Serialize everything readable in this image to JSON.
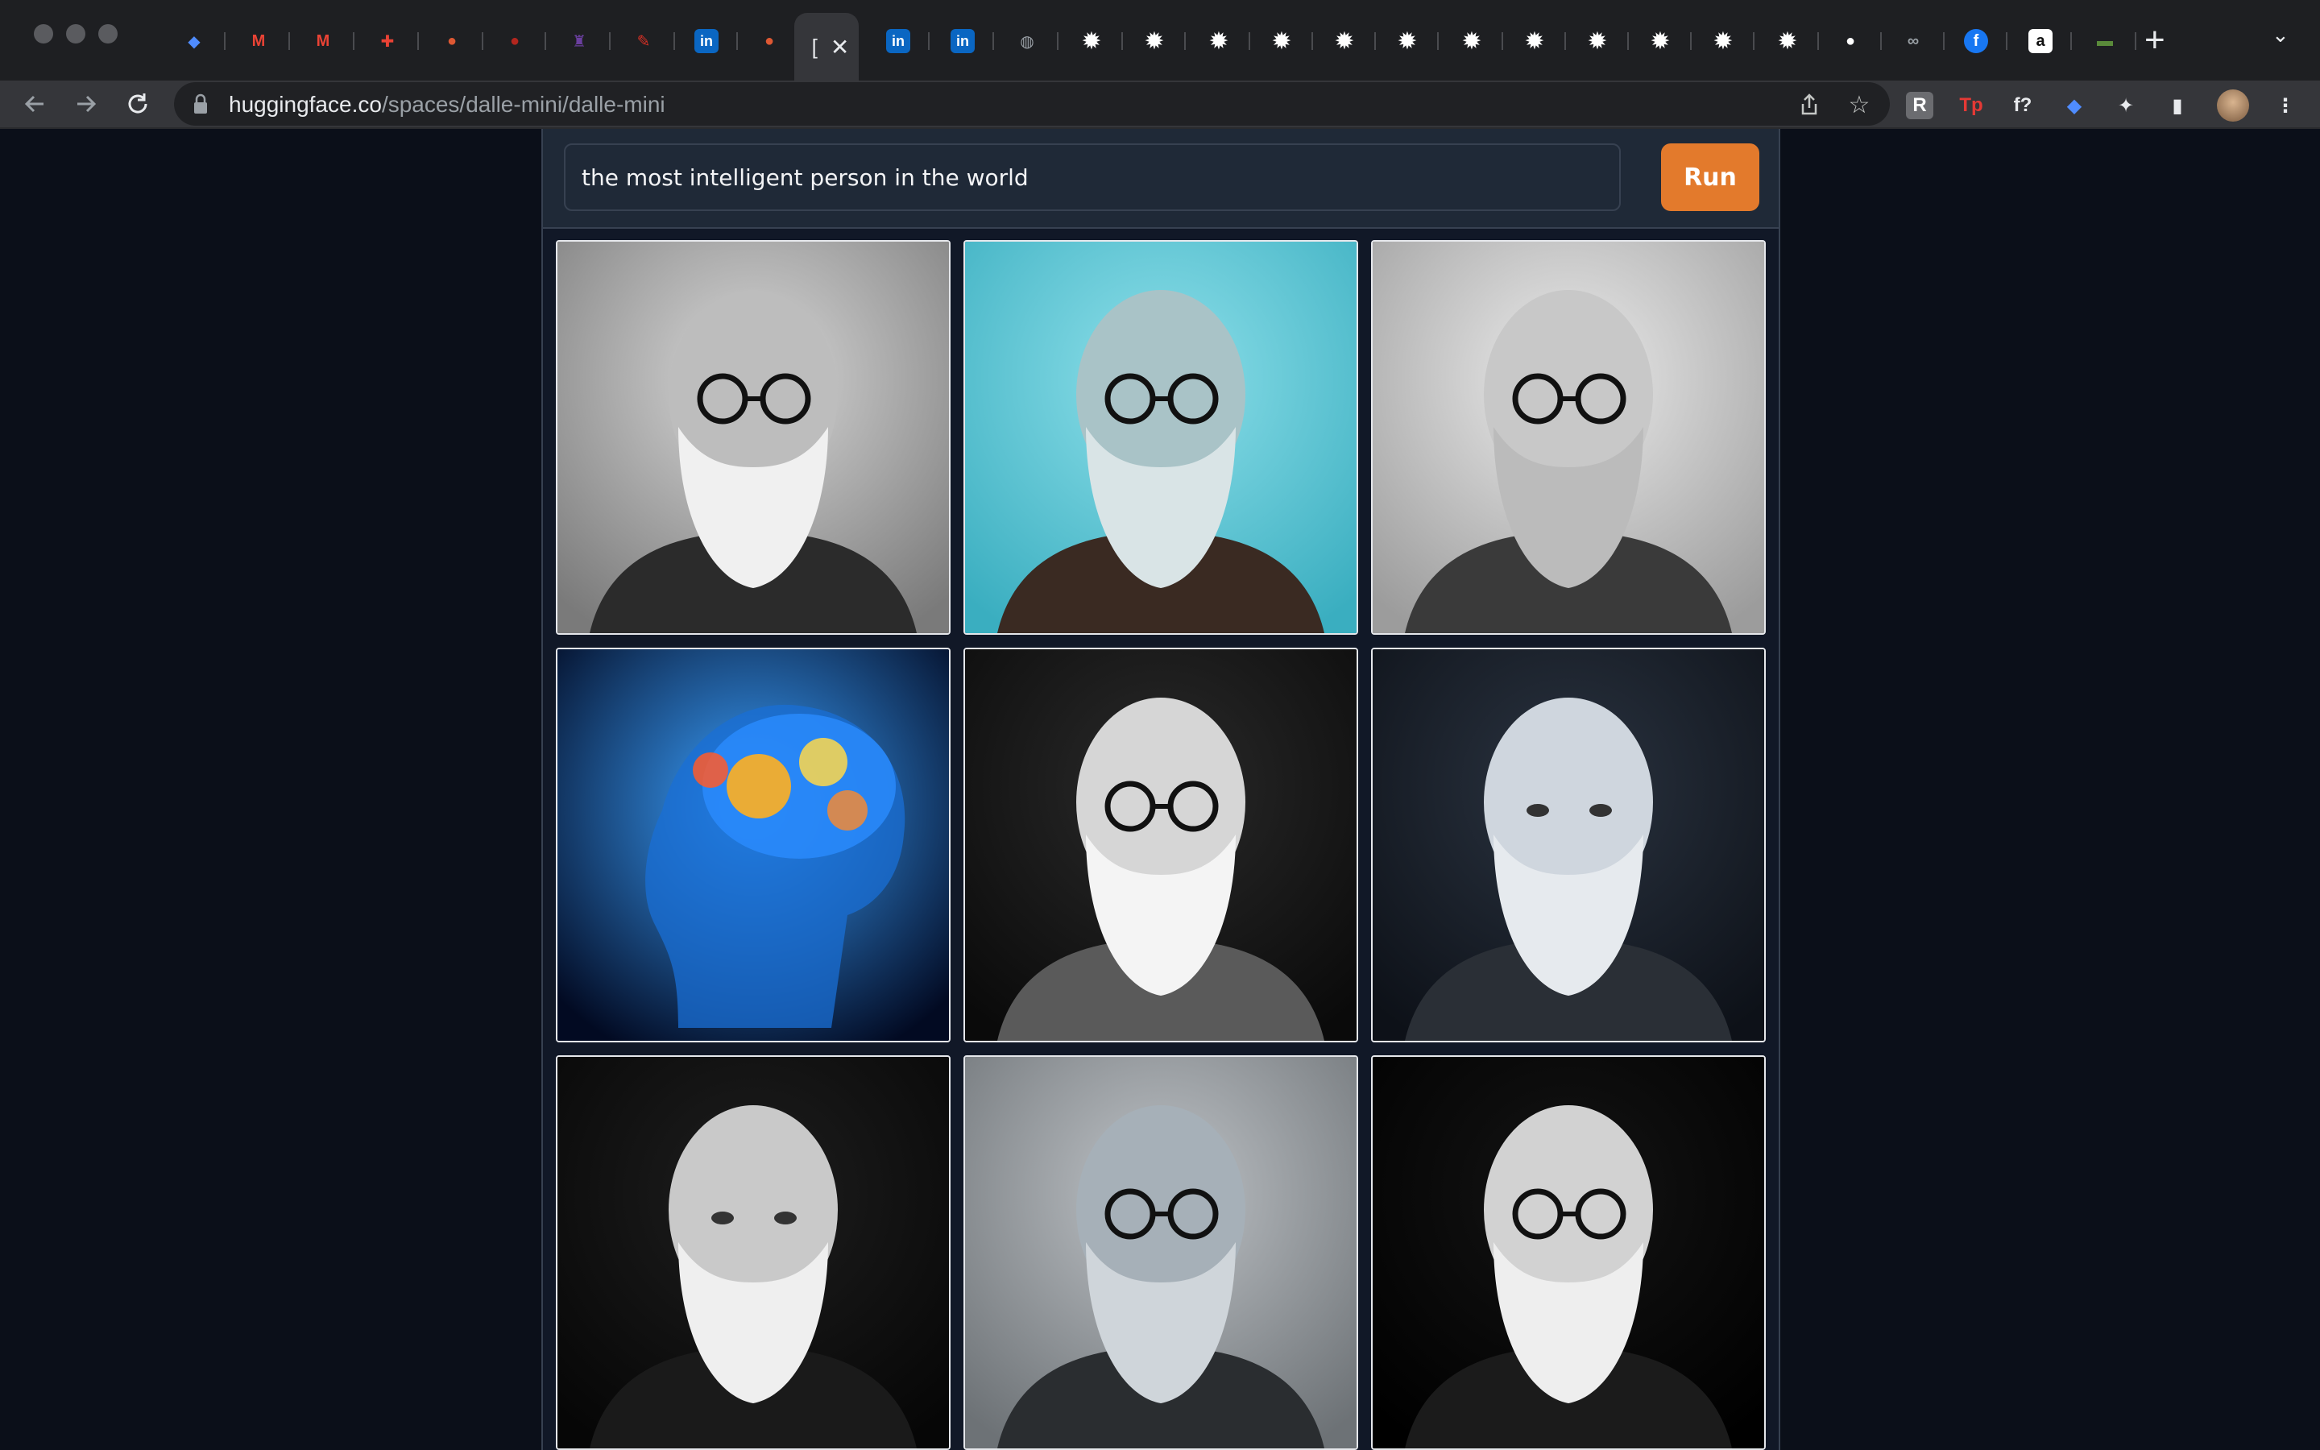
{
  "browser": {
    "tabs": [
      {
        "icon": "diamond-icon",
        "color": "#4f8cff"
      },
      {
        "icon": "gmail-icon",
        "color": "#ea4335"
      },
      {
        "icon": "gmail-icon",
        "color": "#ea4335"
      },
      {
        "icon": "app-icon",
        "color": "#e94235"
      },
      {
        "icon": "duckduckgo-icon",
        "color": "#de5833"
      },
      {
        "icon": "red-circle-icon",
        "color": "#b3261e"
      },
      {
        "icon": "purple-app-icon",
        "color": "#6b3fa0"
      },
      {
        "icon": "red-pin-icon",
        "color": "#d93025"
      },
      {
        "icon": "linkedin-icon",
        "color": "#0a66c2"
      },
      {
        "icon": "duckduckgo-icon",
        "color": "#de5833"
      },
      {
        "icon": "linkedin-icon",
        "color": "#0a66c2"
      },
      {
        "icon": "linkedin-icon",
        "color": "#0a66c2"
      },
      {
        "icon": "globe-icon",
        "color": "#9aa0a6"
      },
      {
        "icon": "gear-icon",
        "color": "#ffffff"
      },
      {
        "icon": "gear-icon",
        "color": "#ffffff"
      },
      {
        "icon": "gear-icon",
        "color": "#ffffff"
      },
      {
        "icon": "gear-icon",
        "color": "#ffffff"
      },
      {
        "icon": "gear-icon",
        "color": "#ffffff"
      },
      {
        "icon": "gear-icon",
        "color": "#ffffff"
      },
      {
        "icon": "gear-icon",
        "color": "#ffffff"
      },
      {
        "icon": "gear-icon",
        "color": "#ffffff"
      },
      {
        "icon": "gear-icon",
        "color": "#ffffff"
      },
      {
        "icon": "gear-icon",
        "color": "#ffffff"
      },
      {
        "icon": "gear-icon",
        "color": "#ffffff"
      },
      {
        "icon": "gear-icon",
        "color": "#ffffff"
      },
      {
        "icon": "github-icon",
        "color": "#ffffff"
      },
      {
        "icon": "infinity-icon",
        "color": "#9aa0a6"
      },
      {
        "icon": "facebook-icon",
        "color": "#1877f2"
      },
      {
        "icon": "amazon-icon",
        "color": "#ffffff"
      },
      {
        "icon": "battery-icon",
        "color": "#5a8a3a"
      }
    ],
    "active_tab": {
      "title": "[",
      "close": "✕"
    },
    "new_tab": "+",
    "tab_menu": "⌄",
    "url_host": "huggingface.co",
    "url_path": "/spaces/dalle-mini/dalle-mini",
    "extensions": [
      "R",
      "Tp",
      "f?",
      "◆",
      "✦",
      "▮",
      "avatar"
    ]
  },
  "app": {
    "prompt_value": "the most intelligent person in the world",
    "run_label": "Run",
    "accent": "#e37a2c",
    "images": [
      {
        "name": "bearded-man-glasses-portrait"
      },
      {
        "name": "teal-background-man-portrait"
      },
      {
        "name": "man-round-glasses-portrait"
      },
      {
        "name": "glowing-brain-head-xray"
      },
      {
        "name": "white-beard-man-portrait"
      },
      {
        "name": "bald-man-thinking-portrait"
      },
      {
        "name": "bearded-man-writing-portrait"
      },
      {
        "name": "man-in-suit-portrait"
      },
      {
        "name": "man-glasses-mustache-portrait"
      }
    ]
  }
}
